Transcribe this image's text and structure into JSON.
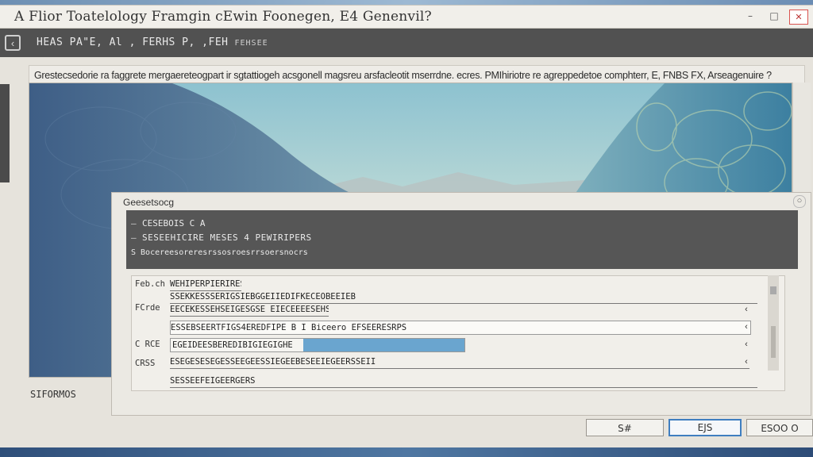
{
  "window": {
    "title": "A Flior Toatelology Framgin cEwin Foonegen, E4 Genenvil?",
    "controls": [
      "–",
      "□",
      "✕"
    ]
  },
  "toolbar": {
    "text": "HEAS PA\"E,  Al ,  FERHS P, ,FEH",
    "subtext": "FEHSEE"
  },
  "description": "Grestecsedorie ra faggrete mergaereteogpart ir sgtattiogeh acsgonell magsreu arsfacleotit mserrdne. ecres. PMIhiriotre re agreppedetoe comphterr, E, FNBS FX, Arseagenuire ?",
  "dialog": {
    "title": "Geesetsocg",
    "close_label": "○",
    "header": {
      "line1": "CESEBOIS C A",
      "line2": "SESEEHICIRE MESES 4 PEWIRIPERS",
      "line3": "S  Bocereesoreresrssosroesrrsoersnocrs"
    },
    "form": {
      "rows": [
        {
          "label": "Feb.ch",
          "value": "WEHIPERPIERIRESER"
        },
        {
          "label": "",
          "value": "SSEKKESSSERIGSIEBGGEIIEDIFKECEOBEEIEB"
        },
        {
          "label": "FCrde",
          "value": "EECEKESSEHSEIGESGSE   EIECEEEESEHSC"
        },
        {
          "label": "",
          "value": "ESSEBSEERTFIGS4EREDFIPE B I   Biceero   EFSEERESRPS"
        },
        {
          "label": "C RCE",
          "value": "EGEIDEESBEREDIBIGIEGIGHE"
        },
        {
          "label": "CRSS",
          "value": "ESEGESESEGESSEEGEESSIEGEEBESEEIEGEERSSEII"
        },
        {
          "label": "",
          "value": "SESSEEFEIGEERGERS"
        }
      ],
      "progress": 0.55
    }
  },
  "status": "SIFORMOS",
  "buttons": {
    "first": "S#",
    "primary": "EJS",
    "last": "ESOO O"
  },
  "colors": {
    "toolbar": "#515151",
    "accent": "#3f7ec0",
    "progress": "#6aa5cf"
  }
}
